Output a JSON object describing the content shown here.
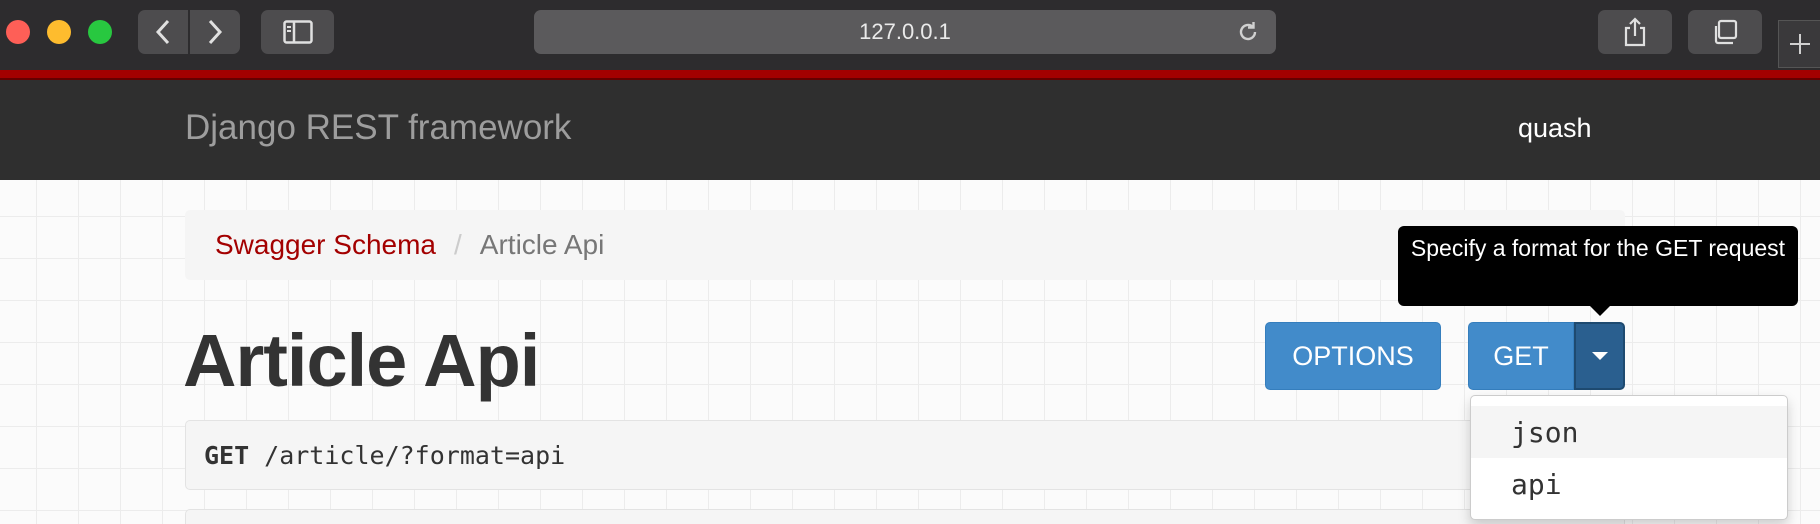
{
  "browser": {
    "url": "127.0.0.1"
  },
  "navbar": {
    "brand": "Django REST framework",
    "user": "quash"
  },
  "breadcrumb": {
    "items": [
      "Swagger Schema",
      "Article Api"
    ],
    "separator": "/"
  },
  "page": {
    "title": "Article Api"
  },
  "buttons": {
    "options_label": "OPTIONS",
    "get_label": "GET"
  },
  "tooltip": {
    "text": "Specify a format for the GET request"
  },
  "request": {
    "method": "GET",
    "path": "/article/?format=api"
  },
  "format_dropdown": {
    "options": [
      "json",
      "api"
    ]
  },
  "colors": {
    "accent": "#a30000",
    "button": "#428bca",
    "navbar": "#2f2f2f"
  }
}
